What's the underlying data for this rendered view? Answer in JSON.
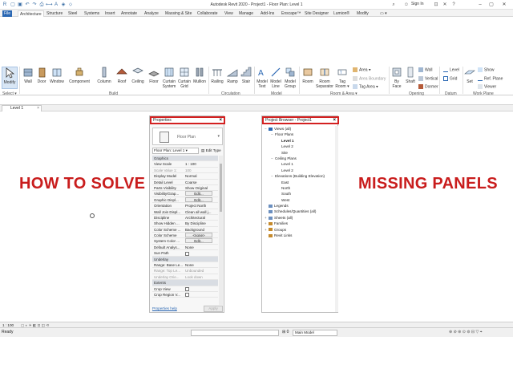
{
  "window": {
    "title": "Autodesk Revit 2020 - Project1 - Floor Plan: Level 1",
    "sign_in": "Sign In",
    "search_hint": "",
    "help": "?"
  },
  "tabs": [
    "File",
    "Architecture",
    "Structure",
    "Steel",
    "Systems",
    "Insert",
    "Annotate",
    "Analyze",
    "Massing & Site",
    "Collaborate",
    "View",
    "Manage",
    "Add-Ins",
    "Enscape™",
    "Site Designer",
    "Lumion®",
    "Modify"
  ],
  "ribbon": {
    "tools": {
      "modify": "Modify",
      "wall": "Wall",
      "door": "Door",
      "window": "Window",
      "component": "Component",
      "column": "Column",
      "roof": "Roof",
      "ceiling": "Ceiling",
      "floor": "Floor",
      "curtain_system": "Curtain System",
      "curtain_grid": "Curtain Grid",
      "mullion": "Mullion",
      "railing": "Railing",
      "ramp": "Ramp",
      "stair": "Stair",
      "model_text": "Model Text",
      "model_line": "Model Line",
      "model_group": "Model Group",
      "room": "Room",
      "room_separator": "Room Separator",
      "tag_room": "Tag Room",
      "area": "Area",
      "area_boundary": "Area Boundary",
      "tag_area": "Tag Area",
      "by_face": "By Face",
      "shaft": "Shaft",
      "wall_opening": "Wall",
      "vertical": "Vertical",
      "dormer": "Dormer",
      "level": "Level",
      "grid": "Grid",
      "set": "Set",
      "show": "Show",
      "ref_plane": "Ref. Plane",
      "viewer": "Viewer"
    },
    "panels": {
      "select": "Select",
      "build": "Build",
      "circulation": "Circulation",
      "model": "Model",
      "room_area": "Room & Area",
      "opening": "Opening",
      "datum": "Datum",
      "work_plane": "Work Plane"
    }
  },
  "view_tab": {
    "label": "Level 1",
    "close": "×"
  },
  "headline": {
    "left": "HOW TO SOLVE",
    "right": "MISSING PANELS"
  },
  "properties": {
    "title": "Properties",
    "close": "×",
    "type_name": "Floor Plan",
    "instance": "Floor Plan: Level 1",
    "edit_type": "Edit Type",
    "rows": [
      {
        "k": "Graphics",
        "v": "",
        "group": true
      },
      {
        "k": "View Scale",
        "v": "1 : 100"
      },
      {
        "k": "Scale Value  1:",
        "v": "100",
        "dim": true
      },
      {
        "k": "Display Model",
        "v": "Normal"
      },
      {
        "k": "Detail Level",
        "v": "Coarse"
      },
      {
        "k": "Parts Visibility",
        "v": "Show Original"
      },
      {
        "k": "Visibility/Grap...",
        "v": "Edit...",
        "btn": true
      },
      {
        "k": "Graphic Displ...",
        "v": "Edit...",
        "btn": true
      },
      {
        "k": "Orientation",
        "v": "Project North"
      },
      {
        "k": "Wall Join Displ...",
        "v": "Clean all wall j..."
      },
      {
        "k": "Discipline",
        "v": "Architectural"
      },
      {
        "k": "Show Hidden ...",
        "v": "By Discipline"
      },
      {
        "k": "Color Scheme ...",
        "v": "Background"
      },
      {
        "k": "Color Scheme",
        "v": "<none>",
        "btn": true
      },
      {
        "k": "System Color ...",
        "v": "Edit...",
        "btn": true
      },
      {
        "k": "Default Analys...",
        "v": "None"
      },
      {
        "k": "Sun Path",
        "v": "",
        "check": true
      },
      {
        "k": "Underlay",
        "v": "",
        "group": true
      },
      {
        "k": "Range: Base Le...",
        "v": "None"
      },
      {
        "k": "Range: Top Le...",
        "v": "Unbounded",
        "dim": true
      },
      {
        "k": "Underlay Orie...",
        "v": "Look down",
        "dim": true
      },
      {
        "k": "Extents",
        "v": "",
        "group": true
      },
      {
        "k": "Crop View",
        "v": "",
        "check": true
      },
      {
        "k": "Crop Region V...",
        "v": "",
        "check": true
      }
    ],
    "help": "Properties help",
    "apply": "Apply"
  },
  "browser": {
    "title": "Project Browser - Project1",
    "close": "×",
    "nodes": [
      {
        "t": "Views (all)",
        "d": 0,
        "tg": "−",
        "ic": "#2a67b3"
      },
      {
        "t": "Floor Plans",
        "d": 1,
        "tg": "−"
      },
      {
        "t": "Level 1",
        "d": 2,
        "bold": true
      },
      {
        "t": "Level 2",
        "d": 2
      },
      {
        "t": "Site",
        "d": 2
      },
      {
        "t": "Ceiling Plans",
        "d": 1,
        "tg": "−"
      },
      {
        "t": "Level 1",
        "d": 2
      },
      {
        "t": "Level 2",
        "d": 2
      },
      {
        "t": "Elevations (Building Elevation)",
        "d": 1,
        "tg": "−"
      },
      {
        "t": "East",
        "d": 2
      },
      {
        "t": "North",
        "d": 2
      },
      {
        "t": "South",
        "d": 2
      },
      {
        "t": "West",
        "d": 2
      },
      {
        "t": "Legends",
        "d": 0,
        "ic": "#6b8fbf"
      },
      {
        "t": "Schedules/Quantities (all)",
        "d": 0,
        "ic": "#6b8fbf"
      },
      {
        "t": "Sheets (all)",
        "d": 0,
        "tg": "+",
        "ic": "#6b8fbf"
      },
      {
        "t": "Families",
        "d": 0,
        "tg": "+",
        "ic": "#c58a2c"
      },
      {
        "t": "Groups",
        "d": 0,
        "tg": "+",
        "ic": "#c58a2c"
      },
      {
        "t": "Revit Links",
        "d": 0,
        "ic": "#c58a2c"
      }
    ]
  },
  "status": {
    "scale": "1 : 100",
    "ready": "Ready",
    "workset": "0",
    "model": "Main Model"
  },
  "colors": {
    "accent": "#2a67b3",
    "headline": "#c91d1d",
    "highlight_border": "#d32020"
  }
}
